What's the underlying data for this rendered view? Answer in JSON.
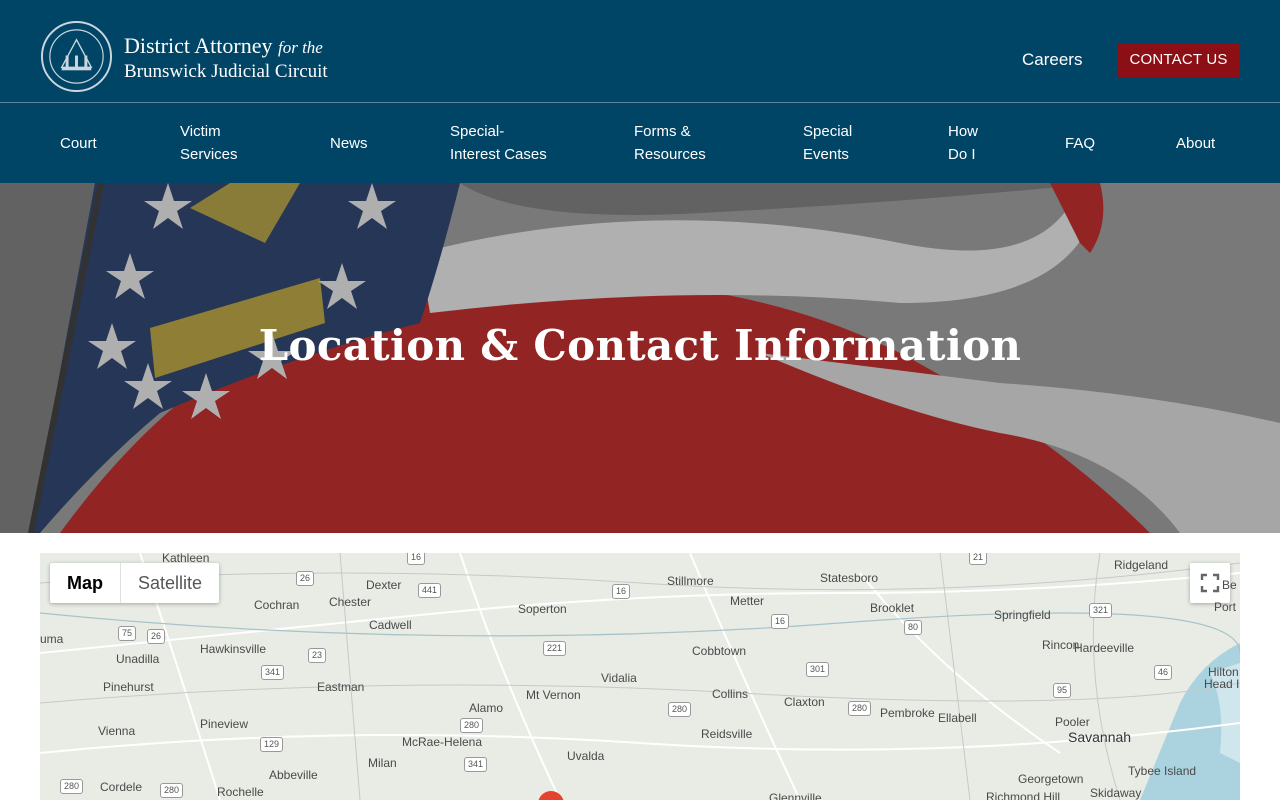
{
  "header": {
    "brand_line1": "District Attorney",
    "brand_line1_suffix": "for the",
    "brand_line2": "Brunswick Judicial Circuit",
    "careers_label": "Careers",
    "contact_label": "CONTACT US",
    "colors": {
      "navy": "#004466",
      "contact_red": "#8b0f14"
    }
  },
  "nav": {
    "court": "Court",
    "victim_1": "Victim",
    "victim_2": "Services",
    "news": "News",
    "special_interest_1": "Special-",
    "special_interest_2": "Interest Cases",
    "forms_1": "Forms &",
    "forms_2": "Resources",
    "events_1": "Special",
    "events_2": "Events",
    "howdoi_1": "How",
    "howdoi_2": "Do I",
    "faq": "FAQ",
    "about": "About"
  },
  "hero": {
    "title": "Location & Contact Information"
  },
  "map": {
    "map_label": "Map",
    "satellite_label": "Satellite",
    "places": [
      "Kathleen",
      "Dexter",
      "Stillmore",
      "Statesboro",
      "Ridgeland",
      "Cochran",
      "Chester",
      "Soperton",
      "Metter",
      "Brooklet",
      "Springfield",
      "Cadwell",
      "Rincon",
      "Hardeeville",
      "Unadilla",
      "Hawkinsville",
      "Cobbtown",
      "Vidalia",
      "Pinehurst",
      "Eastman",
      "Collins",
      "Mt Vernon",
      "Alamo",
      "Claxton",
      "Pembroke",
      "Ellabell",
      "Pooler",
      "Pineview",
      "McRae-Helena",
      "Reidsville",
      "Savannah",
      "Vienna",
      "Uvalda",
      "Milan",
      "Abbeville",
      "Georgetown",
      "Tybee Island",
      "Cordele",
      "Rochelle",
      "Glennville",
      "Richmond Hill",
      "Skidaway",
      "uma",
      "Hilton",
      "Head Isla",
      "Port",
      "Be"
    ],
    "shields": [
      "16",
      "26",
      "441",
      "16",
      "21",
      "321",
      "75",
      "26",
      "23",
      "221",
      "16",
      "80",
      "341",
      "301",
      "95",
      "46",
      "280",
      "280",
      "280",
      "129",
      "341",
      "280",
      "280"
    ]
  }
}
